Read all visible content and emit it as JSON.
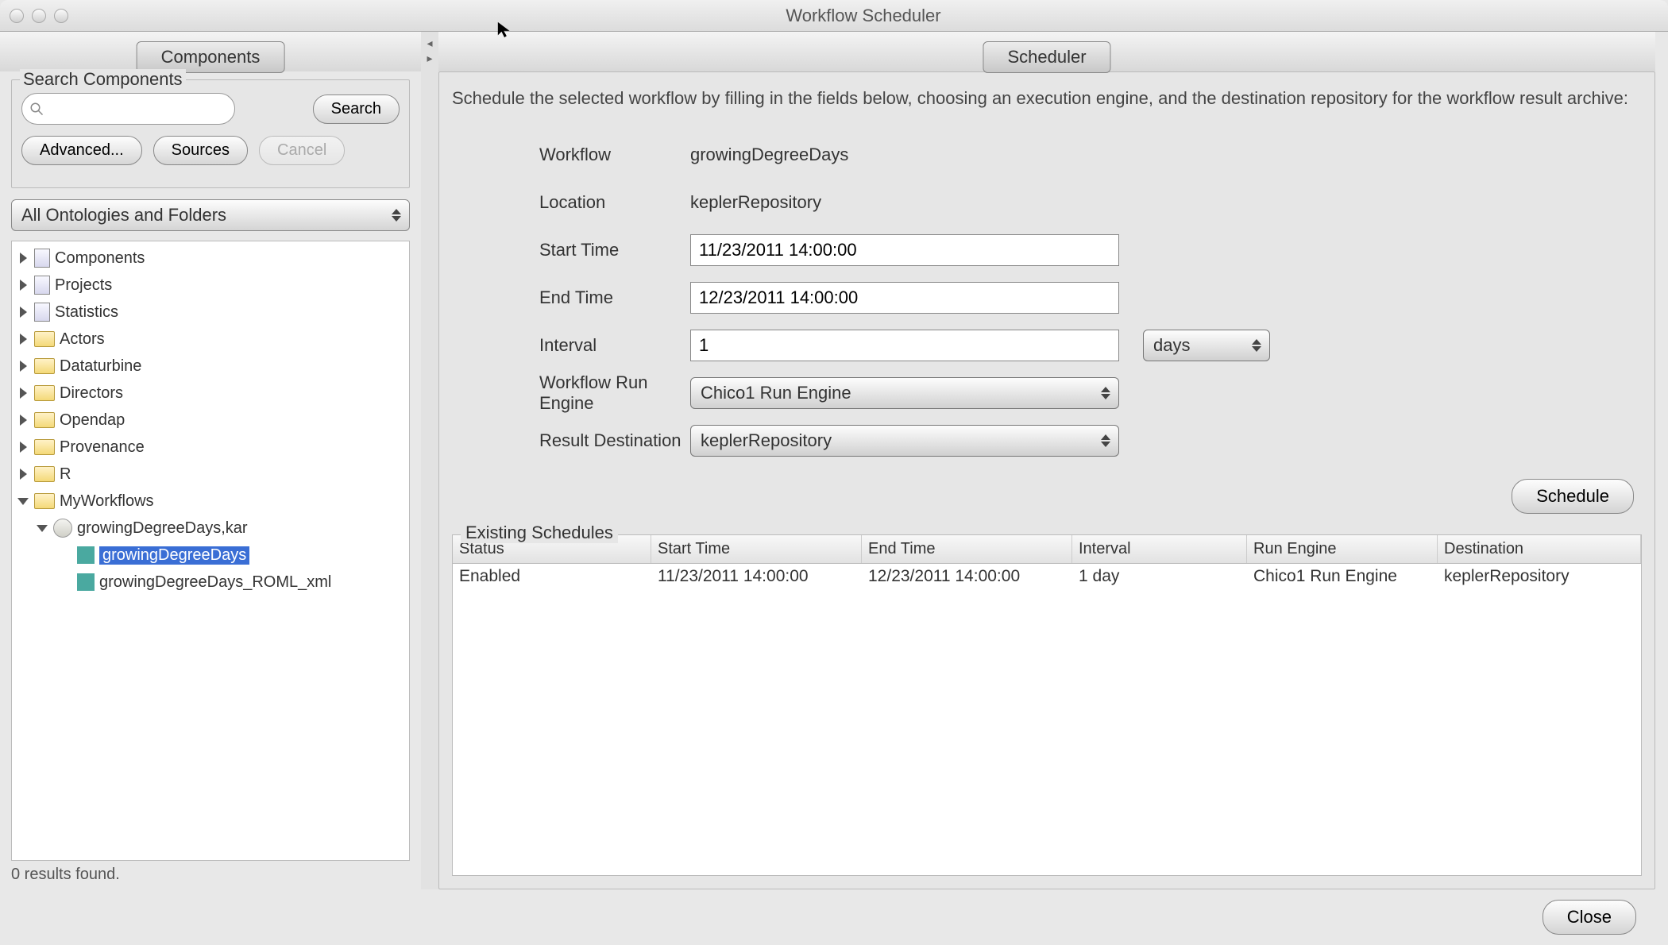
{
  "window": {
    "title": "Workflow Scheduler"
  },
  "left_tab": "Components",
  "search": {
    "legend": "Search Components",
    "placeholder": "",
    "value": "",
    "search_btn": "Search",
    "advanced_btn": "Advanced...",
    "sources_btn": "Sources",
    "cancel_btn": "Cancel"
  },
  "ontology_select": "All Ontologies and Folders",
  "tree": {
    "items": [
      {
        "label": "Components",
        "icon": "doc",
        "expand": "r",
        "indent": 0
      },
      {
        "label": "Projects",
        "icon": "doc",
        "expand": "r",
        "indent": 0
      },
      {
        "label": "Statistics",
        "icon": "doc",
        "expand": "r",
        "indent": 0
      },
      {
        "label": "Actors",
        "icon": "folder",
        "expand": "r",
        "indent": 0
      },
      {
        "label": "Dataturbine",
        "icon": "folder",
        "expand": "r",
        "indent": 0
      },
      {
        "label": "Directors",
        "icon": "folder",
        "expand": "r",
        "indent": 0
      },
      {
        "label": "Opendap",
        "icon": "folder",
        "expand": "r",
        "indent": 0
      },
      {
        "label": "Provenance",
        "icon": "folder",
        "expand": "r",
        "indent": 0
      },
      {
        "label": "R",
        "icon": "folder",
        "expand": "r",
        "indent": 0
      },
      {
        "label": "MyWorkflows",
        "icon": "folder",
        "expand": "d",
        "indent": 0
      },
      {
        "label": "growingDegreeDays,kar",
        "icon": "pkg",
        "expand": "d",
        "indent": 1
      },
      {
        "label": "growingDegreeDays",
        "icon": "teal",
        "expand": "",
        "indent": 2,
        "selected": true
      },
      {
        "label": "growingDegreeDays_ROML_xml",
        "icon": "teal",
        "expand": "",
        "indent": 2
      }
    ]
  },
  "status": "0 results found.",
  "right_tab": "Scheduler",
  "intro": "Schedule the selected workflow by filling in the fields below, choosing an execution engine, and the destination repository for the workflow result archive:",
  "form": {
    "workflow_label": "Workflow",
    "workflow_value": "growingDegreeDays",
    "location_label": "Location",
    "location_value": "keplerRepository",
    "start_label": "Start Time",
    "start_value": "11/23/2011 14:00:00",
    "end_label": "End Time",
    "end_value": "12/23/2011 14:00:00",
    "interval_label": "Interval",
    "interval_value": "1",
    "interval_unit": "days",
    "engine_label": "Workflow Run Engine",
    "engine_value": "Chico1 Run Engine",
    "dest_label": "Result Destination",
    "dest_value": "keplerRepository"
  },
  "schedule_btn": "Schedule",
  "existing_legend": "Existing Schedules",
  "table": {
    "headers": [
      "Status",
      "Start Time",
      "End Time",
      "Interval",
      "Run Engine",
      "Destination"
    ],
    "rows": [
      [
        "Enabled",
        "11/23/2011 14:00:00",
        "12/23/2011 14:00:00",
        "1 day",
        "Chico1 Run Engine",
        "keplerRepository"
      ]
    ]
  },
  "close_btn": "Close"
}
